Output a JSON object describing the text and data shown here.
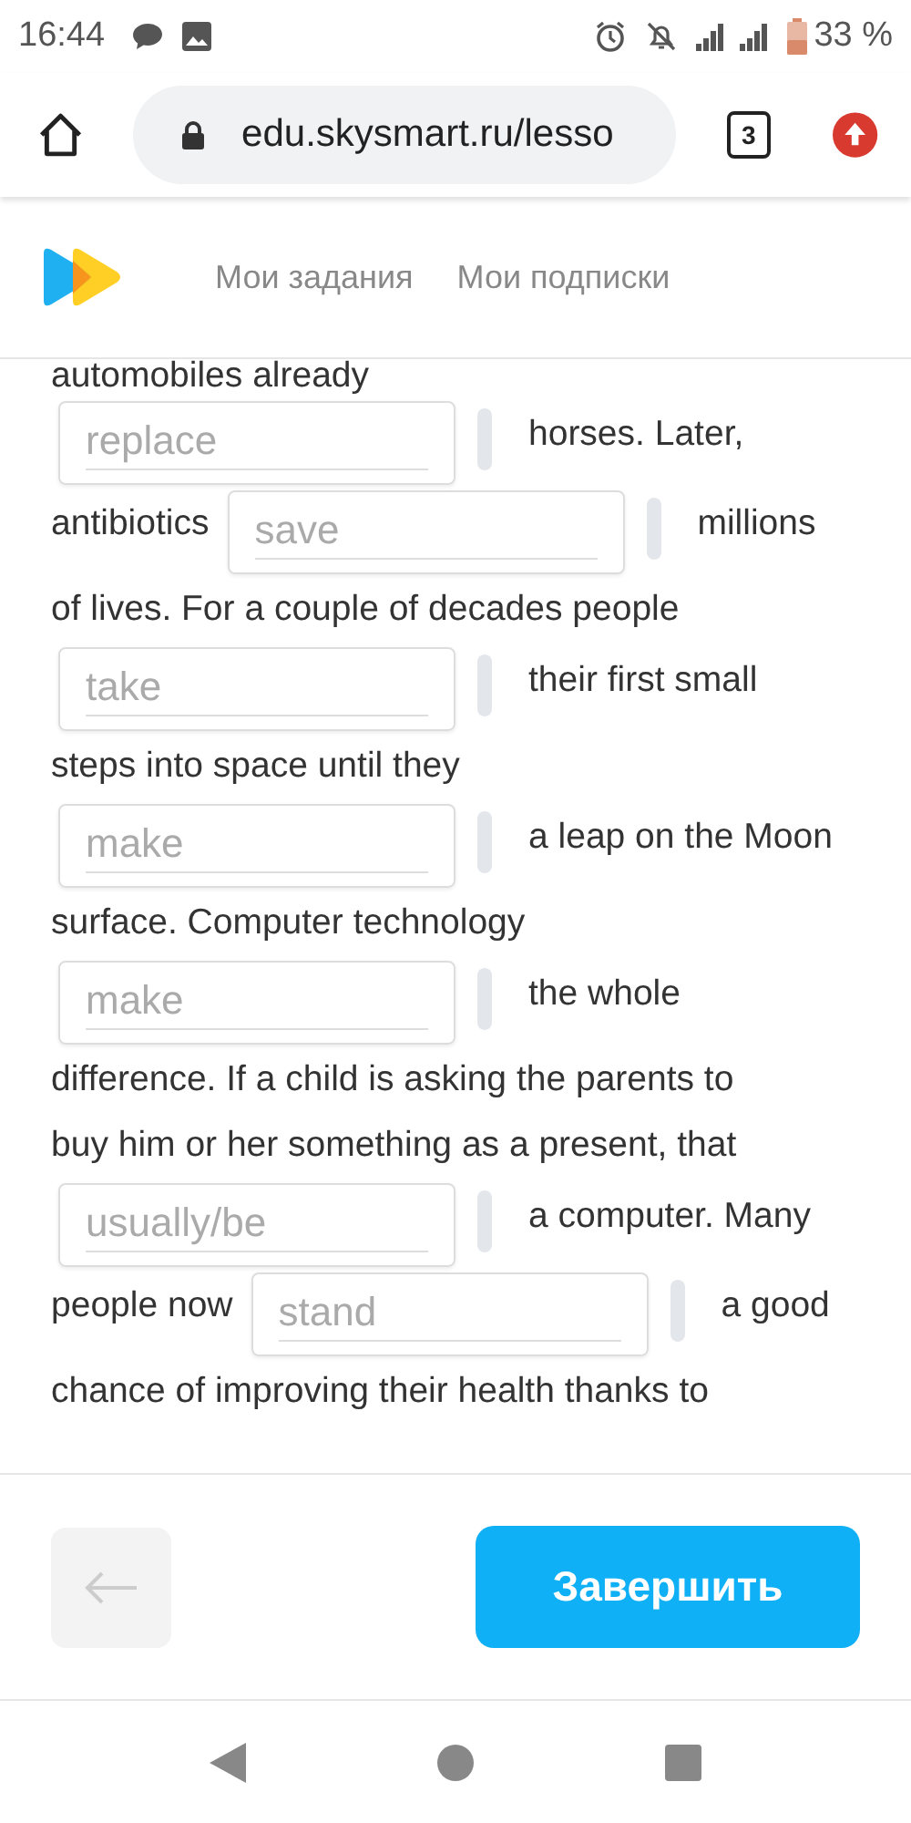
{
  "status_bar": {
    "time": "16:44",
    "battery": "33 %"
  },
  "browser": {
    "url": "edu.skysmart.ru/lesso",
    "tab_count": "3"
  },
  "nav": [
    {
      "label": "Мои задания"
    },
    {
      "label": "Мои подписки"
    }
  ],
  "exercise": {
    "lines": [
      [
        {
          "kind": "text",
          "text": "automobiles already"
        }
      ],
      [
        {
          "kind": "blank",
          "placeholder": "replace"
        },
        {
          "kind": "text",
          "text": "horses. Later,"
        }
      ],
      [
        {
          "kind": "text",
          "text": "antibiotics"
        },
        {
          "kind": "blank",
          "placeholder": "save"
        },
        {
          "kind": "text",
          "text": "millions"
        }
      ],
      [
        {
          "kind": "text",
          "text": "of lives. For a couple of decades people"
        }
      ],
      [
        {
          "kind": "blank",
          "placeholder": "take"
        },
        {
          "kind": "text",
          "text": "their first small"
        }
      ],
      [
        {
          "kind": "text",
          "text": "steps into space until they"
        }
      ],
      [
        {
          "kind": "blank",
          "placeholder": "make"
        },
        {
          "kind": "text",
          "text": "a leap on the Moon"
        }
      ],
      [
        {
          "kind": "text",
          "text": "surface. Computer technology"
        }
      ],
      [
        {
          "kind": "blank",
          "placeholder": "make"
        },
        {
          "kind": "text",
          "text": "the whole"
        }
      ],
      [
        {
          "kind": "text",
          "text": "difference. If a child is asking the parents to"
        }
      ],
      [
        {
          "kind": "text",
          "text": "buy him or her something as a present, that"
        }
      ],
      [
        {
          "kind": "blank",
          "placeholder": "usually/be"
        },
        {
          "kind": "text",
          "text": "a computer. Many"
        }
      ],
      [
        {
          "kind": "text",
          "text": "people now"
        },
        {
          "kind": "blank",
          "placeholder": "stand"
        },
        {
          "kind": "text",
          "text": "a good"
        }
      ],
      [
        {
          "kind": "text",
          "text": "chance of improving their health thanks to"
        }
      ]
    ]
  },
  "footer": {
    "back_button": {
      "disabled": true
    },
    "finish_button": "Завершить"
  }
}
